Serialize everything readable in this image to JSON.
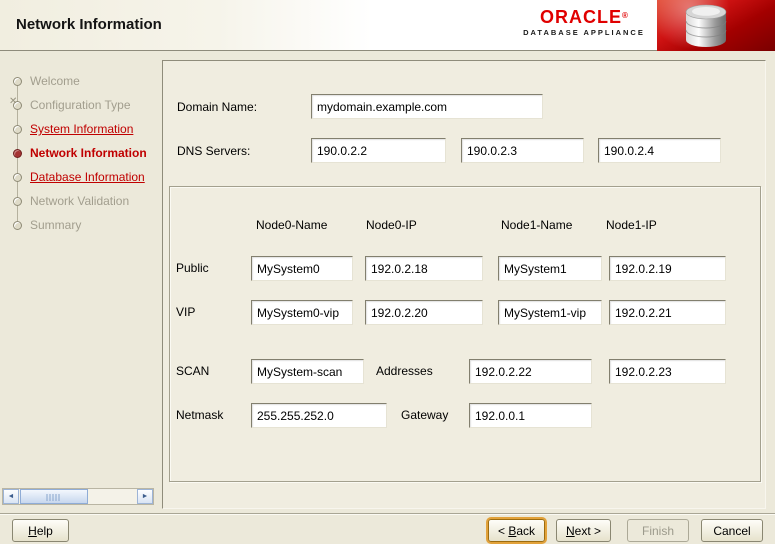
{
  "window": {
    "title": "Network Information"
  },
  "brand": {
    "name": "ORACLE",
    "reg": "®",
    "subtitle": "DATABASE APPLIANCE"
  },
  "colors": {
    "oracle_red": "#E00000",
    "link_red": "#C00000",
    "header_red_dark": "#7A0000",
    "background": "#ECE9DA"
  },
  "icons": {
    "path_cross": "✕",
    "scroll_left": "◄",
    "scroll_right": "►"
  },
  "sidebar": {
    "steps": [
      {
        "label": "Welcome",
        "state": "inactive"
      },
      {
        "label": "Configuration Type",
        "state": "inactive"
      },
      {
        "label": "System Information",
        "state": "visited-link"
      },
      {
        "label": "Network Information",
        "state": "current"
      },
      {
        "label": "Database Information",
        "state": "visited-link"
      },
      {
        "label": "Network Validation",
        "state": "inactive"
      },
      {
        "label": "Summary",
        "state": "inactive"
      }
    ]
  },
  "form": {
    "domain": {
      "label": "Domain Name:",
      "value": "mydomain.example.com"
    },
    "dns": {
      "label": "DNS Servers:",
      "values": [
        "190.0.2.2",
        "190.0.2.3",
        "190.0.2.4"
      ]
    },
    "node_table": {
      "headers": [
        "Node0-Name",
        "Node0-IP",
        "Node1-Name",
        "Node1-IP"
      ],
      "rows": {
        "public": {
          "label": "Public",
          "values": [
            "MySystem0",
            "192.0.2.18",
            "MySystem1",
            "192.0.2.19"
          ]
        },
        "vip": {
          "label": "VIP",
          "values": [
            "MySystem0-vip",
            "192.0.2.20",
            "MySystem1-vip",
            "192.0.2.21"
          ]
        },
        "scan": {
          "label": "SCAN",
          "name": "MySystem-scan",
          "addresses_label": "Addresses",
          "addresses": [
            "192.0.2.22",
            "192.0.2.23"
          ]
        },
        "netmask": {
          "label": "Netmask",
          "value": "255.255.252.0",
          "gateway_label": "Gateway",
          "gateway_value": "192.0.0.1"
        }
      }
    }
  },
  "footer": {
    "help": {
      "pre": "",
      "m": "H",
      "post": "elp"
    },
    "back": {
      "pre": "< ",
      "m": "B",
      "post": "ack"
    },
    "next": {
      "pre": "",
      "m": "N",
      "post": "ext >"
    },
    "finish": {
      "label": "Finish"
    },
    "cancel": {
      "label": "Cancel"
    }
  }
}
